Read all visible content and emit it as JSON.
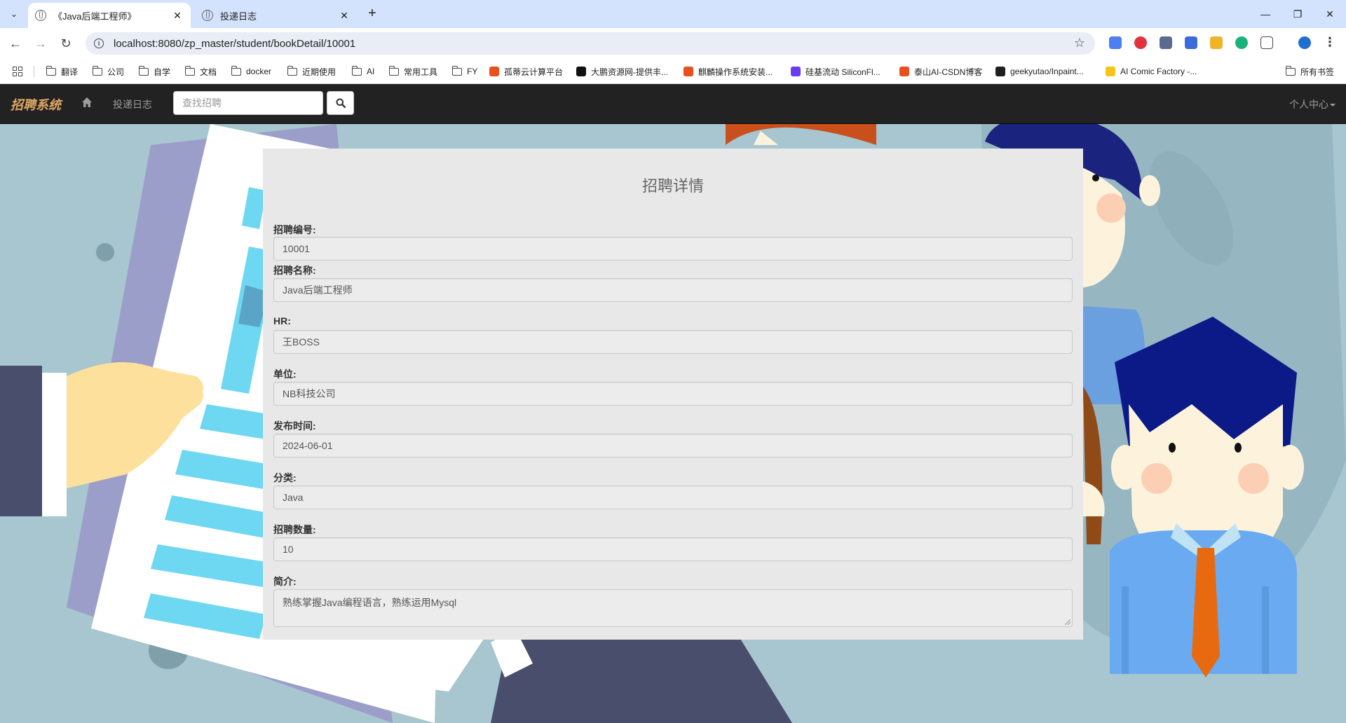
{
  "browser": {
    "tabs": [
      {
        "title": "《Java后端工程师》",
        "active": true
      },
      {
        "title": "投递日志",
        "active": false
      }
    ],
    "url": "localhost:8080/zp_master/student/bookDetail/10001",
    "bookmarks": [
      {
        "label": "翻译",
        "type": "folder"
      },
      {
        "label": "公司",
        "type": "folder"
      },
      {
        "label": "自学",
        "type": "folder"
      },
      {
        "label": "文档",
        "type": "folder"
      },
      {
        "label": "docker",
        "type": "folder"
      },
      {
        "label": "近期使用",
        "type": "folder"
      },
      {
        "label": "AI",
        "type": "folder"
      },
      {
        "label": "常用工具",
        "type": "folder"
      },
      {
        "label": "FY",
        "type": "folder"
      },
      {
        "label": "孤蒂云计算平台",
        "type": "site",
        "color": "#e8501f"
      },
      {
        "label": "大鹏资源网-提供丰...",
        "type": "site",
        "color": "#111111"
      },
      {
        "label": "麒麟操作系统安装...",
        "type": "site",
        "color": "#e8501f"
      },
      {
        "label": "硅基流动 SiliconFl...",
        "type": "site",
        "color": "#6c3cf0"
      },
      {
        "label": "泰山AI-CSDN博客",
        "type": "site",
        "color": "#e8501f"
      },
      {
        "label": "geekyutao/Inpaint...",
        "type": "site",
        "color": "#1f1f1f"
      },
      {
        "label": "AI Comic Factory -...",
        "type": "site",
        "color": "#f5c518"
      }
    ],
    "all_bookmarks_label": "所有书签"
  },
  "navbar": {
    "brand": "招聘系统",
    "log_link": "投递日志",
    "search_placeholder": "查找招聘",
    "user_menu": "个人中心"
  },
  "detail": {
    "title": "招聘详情",
    "fields": [
      {
        "label": "招聘编号:",
        "value": "10001"
      },
      {
        "label": "招聘名称:",
        "value": "Java后端工程师"
      },
      {
        "label": "HR:",
        "value": "王BOSS"
      },
      {
        "label": "单位:",
        "value": "NB科技公司"
      },
      {
        "label": "发布时间:",
        "value": "2024-06-01"
      },
      {
        "label": "分类:",
        "value": "Java"
      },
      {
        "label": "招聘数量:",
        "value": "10"
      },
      {
        "label": "简介:",
        "value": "熟练掌握Java编程语言，熟练运用Mysql"
      }
    ]
  },
  "colors": {
    "navbar_bg": "#222222",
    "brand": "#e0a866",
    "page_bg": "#a8c6d0",
    "panel_bg": "#e8e8e8"
  }
}
